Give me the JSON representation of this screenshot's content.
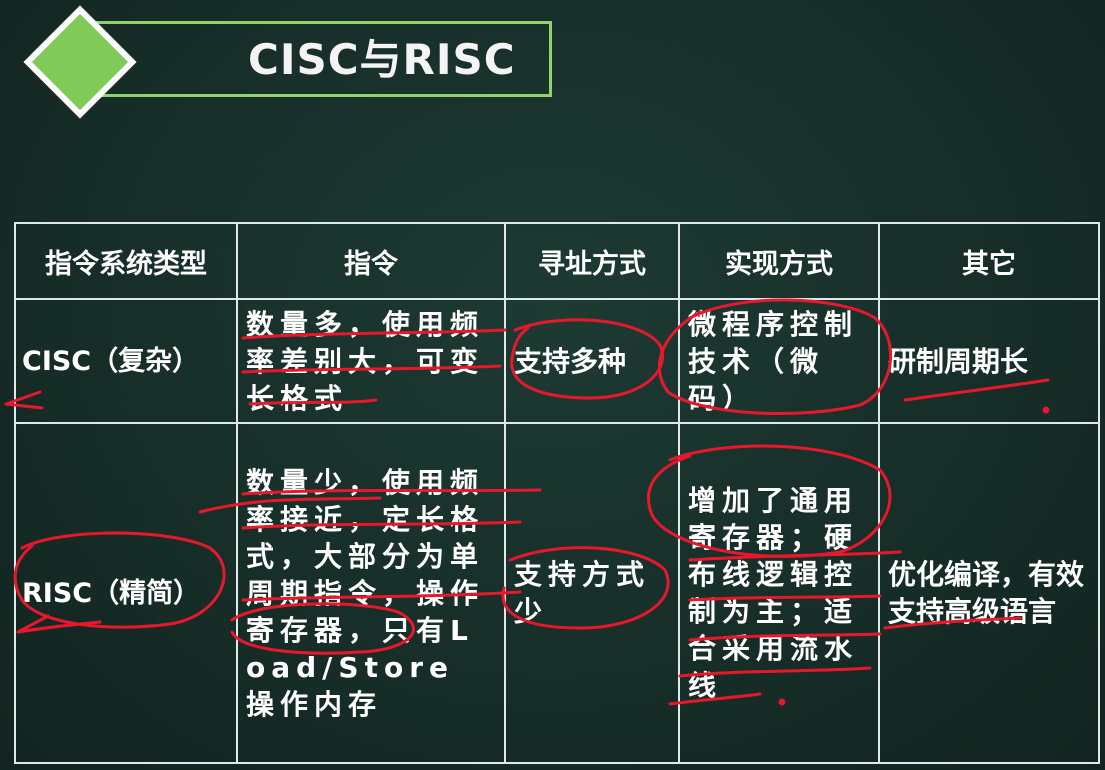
{
  "slide": {
    "title": "CISC与RISC"
  },
  "table": {
    "headers": [
      "指令系统类型",
      "指令",
      "寻址方式",
      "实现方式",
      "其它"
    ],
    "rows": [
      [
        "CISC（复杂）",
        "数量多，使用频率差别大，可变长格式",
        "支持多种",
        "微程序控制技术（微码）",
        "研制周期长"
      ],
      [
        "RISC（精简）",
        "数量少，使用频率接近，定长格式，大部分为单周期指令，操作寄存器，只有Load/Store 操作内存",
        "支持方式少",
        "增加了通用寄存器；硬布线逻辑控制为主；适合采用流水线",
        "优化编译，有效支持高级语言"
      ]
    ]
  },
  "colors": {
    "background": "#172e29",
    "accent_green": "#8fd36a",
    "table_border": "#dfe8ea",
    "annotation_red": "#e8182c"
  }
}
